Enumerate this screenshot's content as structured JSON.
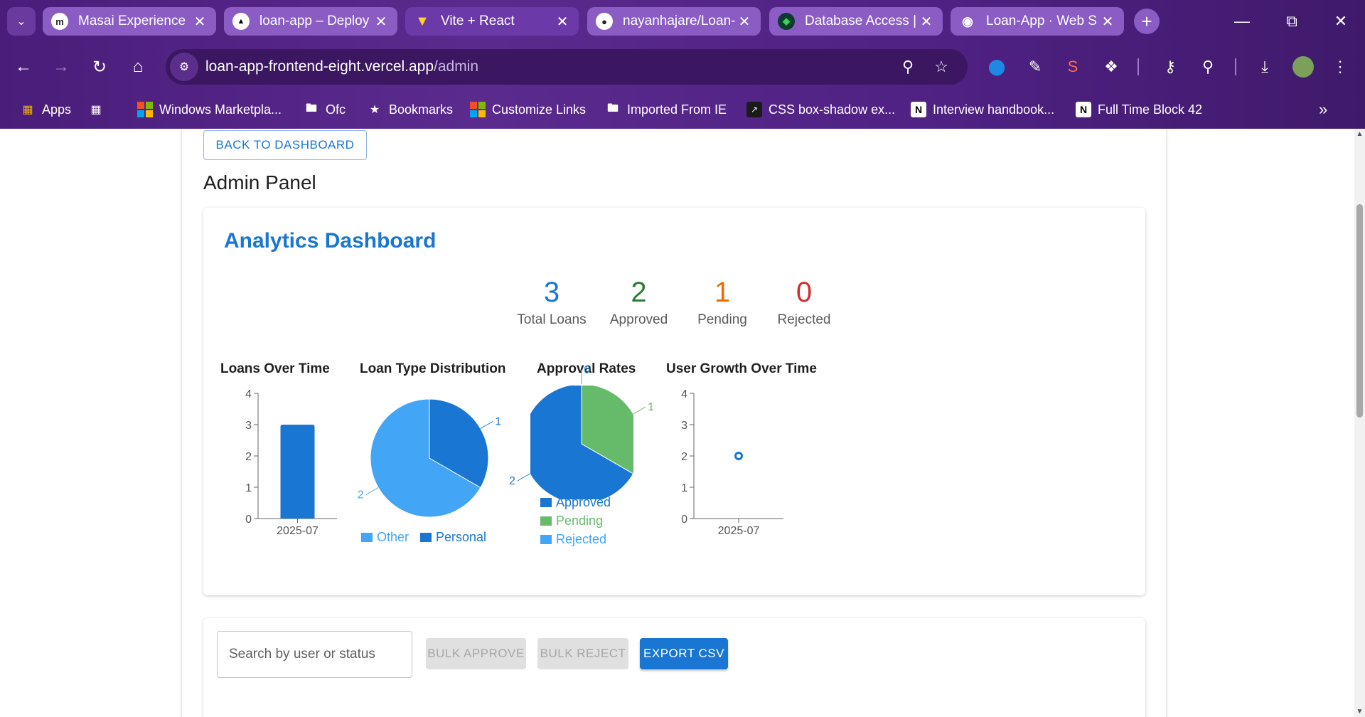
{
  "browser": {
    "tabs": [
      {
        "title": "Masai Experience",
        "icon": "masai-icon",
        "active": false
      },
      {
        "title": "loan-app – Deploy",
        "icon": "vercel-icon",
        "active": false
      },
      {
        "title": "Vite + React",
        "icon": "vite-icon",
        "active": true
      },
      {
        "title": "nayanhajare/Loan-",
        "icon": "github-icon",
        "active": false
      },
      {
        "title": "Database Access |",
        "icon": "mongodb-icon",
        "active": false
      },
      {
        "title": "Loan-App · Web S",
        "icon": "render-icon",
        "active": false
      }
    ],
    "url_host": "loan-app-frontend-eight.vercel.app",
    "url_path": "/admin",
    "bookmarks": [
      {
        "label": "Apps"
      },
      {
        "label": ""
      },
      {
        "label": "Windows Marketpla..."
      },
      {
        "label": "Ofc"
      },
      {
        "label": "Bookmarks"
      },
      {
        "label": "Customize Links"
      },
      {
        "label": "Imported From IE"
      },
      {
        "label": "CSS box-shadow ex..."
      },
      {
        "label": "Interview handbook..."
      },
      {
        "label": "Full Time Block 42"
      }
    ]
  },
  "page": {
    "back_button": "BACK TO DASHBOARD",
    "title": "Admin Panel",
    "analytics": {
      "title": "Analytics Dashboard",
      "stats": [
        {
          "value": "3",
          "label": "Total Loans",
          "color": "#1976d2"
        },
        {
          "value": "2",
          "label": "Approved",
          "color": "#2e7d32"
        },
        {
          "value": "1",
          "label": "Pending",
          "color": "#ed6c02"
        },
        {
          "value": "0",
          "label": "Rejected",
          "color": "#d32f2f"
        }
      ]
    },
    "search_placeholder": "Search by user or status",
    "buttons": {
      "bulk_approve": "BULK APPROVE",
      "bulk_reject": "BULK REJECT",
      "export_csv": "EXPORT CSV"
    }
  },
  "chart_data": [
    {
      "type": "bar",
      "title": "Loans Over Time",
      "categories": [
        "2025-07"
      ],
      "values": [
        3
      ],
      "ylim": [
        0,
        4
      ],
      "yticks": [
        "0",
        "1",
        "2",
        "3",
        "4"
      ],
      "color": "#1976d2"
    },
    {
      "type": "pie",
      "title": "Loan Type Distribution",
      "labels": [
        "Other",
        "Personal"
      ],
      "values": [
        2,
        1
      ],
      "colors": [
        "#42a5f5",
        "#1976d2"
      ],
      "legend": "bottom"
    },
    {
      "type": "pie",
      "title": "Approval Rates",
      "labels": [
        "Approved",
        "Pending",
        "Rejected"
      ],
      "values": [
        2,
        1,
        0
      ],
      "colors": [
        "#1976d2",
        "#66bb6a",
        "#42a5f5"
      ],
      "legend": "bottom"
    },
    {
      "type": "line",
      "title": "User Growth Over Time",
      "categories": [
        "2025-07"
      ],
      "values": [
        2
      ],
      "ylim": [
        0,
        4
      ],
      "yticks": [
        "0",
        "1",
        "2",
        "3",
        "4"
      ],
      "color": "#1976d2"
    }
  ]
}
